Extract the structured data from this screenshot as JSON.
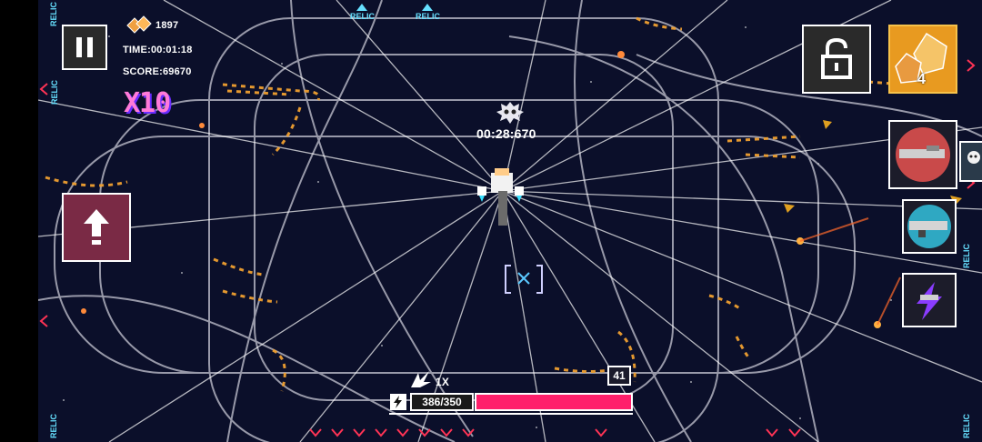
{
  "hud": {
    "currency_value": "1897",
    "time_label": "TIME:00:01:18",
    "score_label": "SCORE:69670",
    "combo_badge": "X10",
    "boss_timer": "00:28:670",
    "dice_count": "4",
    "multiplier": "1X",
    "level_badge": "41",
    "energy_value": "386/350",
    "energy_fill_fraction": 1.0
  },
  "relic_labels": {
    "top_1": "RELIC",
    "top_2": "RELIC",
    "left_top": "RELIC",
    "left_mid": "RELIC",
    "left_bottom": "RELIC",
    "right_mid": "RELIC",
    "right_bottom": "RELIC"
  },
  "colors": {
    "background": "#0b0f2a",
    "energy_bar": "#ff1f6b",
    "relic_text": "#66e0ff",
    "upgrade_button": "#7a2a45",
    "edge_markers": "#ff3355"
  },
  "icons": {
    "pause": "pause-icon",
    "lock": "unlock-icon",
    "dice": "dice-icon",
    "upgrade": "arrow-up-icon",
    "boss": "boss-skull-icon",
    "lightning": "lightning-icon"
  }
}
